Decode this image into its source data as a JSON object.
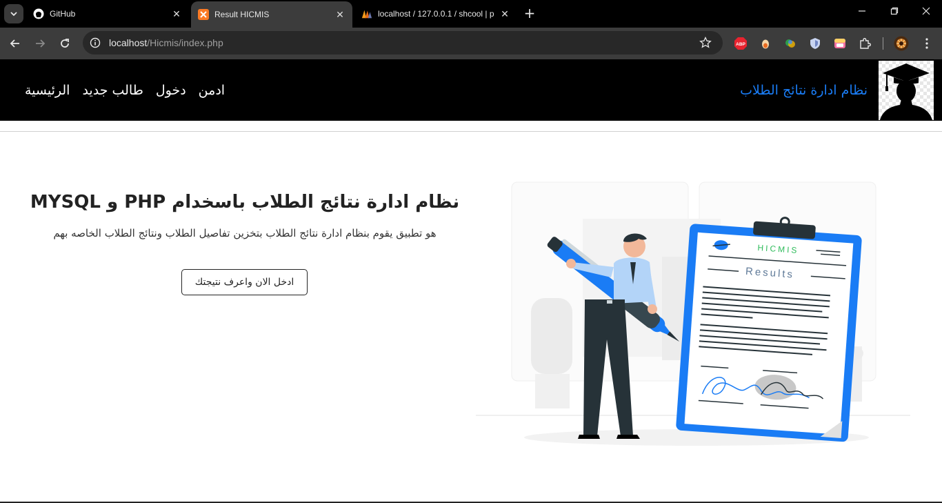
{
  "browser": {
    "tabs": [
      {
        "title": "GitHub",
        "icon": "github-icon",
        "active": false
      },
      {
        "title": "Result HICMIS",
        "icon": "xampp-icon",
        "active": true
      },
      {
        "title": "localhost / 127.0.0.1 / shcool | p",
        "icon": "phpmyadmin-icon",
        "active": false
      }
    ],
    "url_host": "localhost",
    "url_path": "/Hicmis/index.php",
    "extensions": [
      "abp-icon",
      "extension-icon-2",
      "extension-icon-3",
      "shield-icon",
      "extension-icon-5",
      "puzzle-icon"
    ],
    "ext_abp_label": "ABP"
  },
  "navbar": {
    "brand": "نظام ادارة نتائج الطلاب",
    "links": [
      "الرئيسية",
      "طالب جديد",
      "دخول",
      "ادمن"
    ]
  },
  "hero": {
    "title": "نظام ادارة نتائج الطلاب باسخدام PHP و MYSQL",
    "subtitle": "هو تطبيق يقوم بنظام ادارة نتائج الطلاب بتخزين تفاصيل الطلاب ونتائج الطلاب الخاصه بهم",
    "button": "ادخل الان واعرف نتيجتك"
  },
  "illustration": {
    "header": "HICMIS",
    "results": "Results"
  },
  "colors": {
    "brand": "#1a7cf5",
    "navbar_bg": "#000000",
    "accent_blue": "#1a7cf5"
  }
}
